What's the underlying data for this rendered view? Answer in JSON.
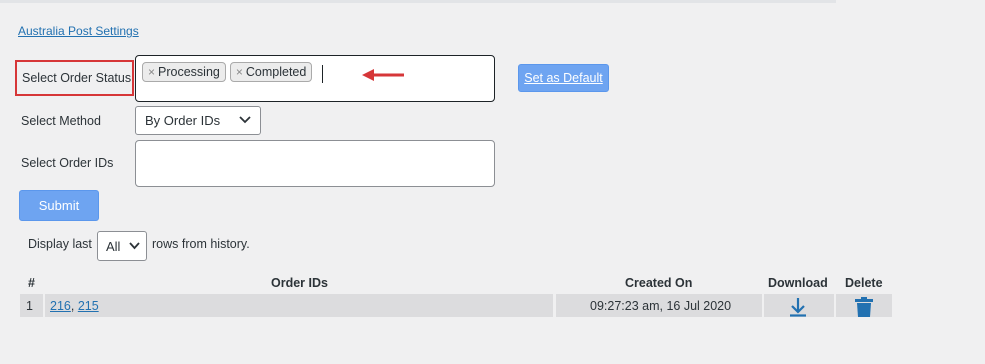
{
  "header": {
    "settings_link": "Australia Post Settings"
  },
  "form": {
    "order_status_label": "Select Order Status",
    "order_status_tags": [
      "Processing",
      "Completed"
    ],
    "tag_remove_glyph": "×",
    "set_default_label": "Set as Default",
    "method_label": "Select Method",
    "method_value": "By Order IDs",
    "order_ids_label": "Select Order IDs",
    "order_ids_value": "",
    "submit_label": "Submit"
  },
  "history": {
    "display_last_label": "Display last",
    "display_last_value": "All",
    "rows_from_label": "rows from history.",
    "columns": [
      "#",
      "Order IDs",
      "Created On",
      "Download",
      "Delete"
    ],
    "rows": [
      {
        "index": "1",
        "order_ids": [
          "216",
          "215"
        ],
        "created_on": "09:27:23 am, 16 Jul 2020"
      }
    ]
  },
  "colors": {
    "accent": "#6ea4f1",
    "link": "#2271b1",
    "highlight": "#d63638",
    "row_bg": "#dcdcde"
  },
  "icons": {
    "tag_remove": "close-icon",
    "select_chevron": "chevron-down-icon",
    "download": "download-icon",
    "delete": "trash-icon",
    "annotation": "arrow-left-icon"
  }
}
